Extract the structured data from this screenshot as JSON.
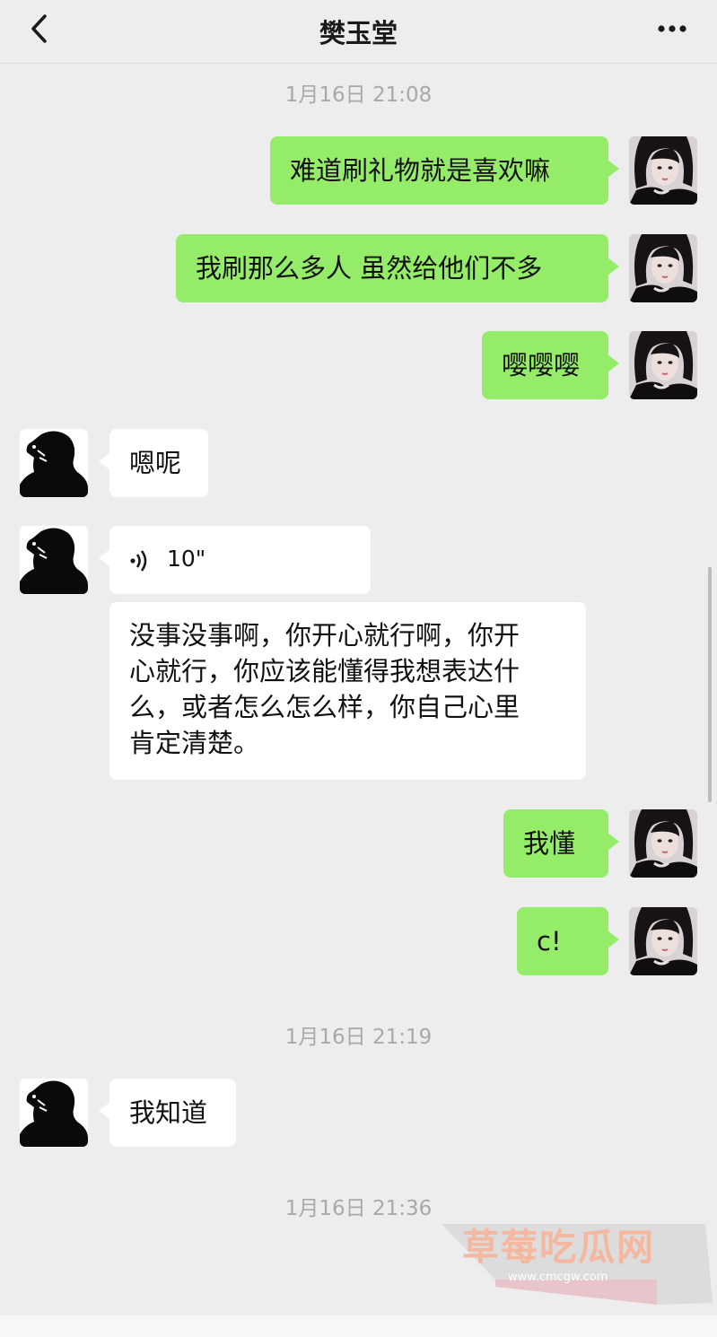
{
  "header": {
    "title": "樊玉堂"
  },
  "timestamps": [
    "1月16日 21:08",
    "1月16日 21:19",
    "1月16日 21:36"
  ],
  "messages": {
    "m1": "难道刷礼物就是喜欢嘛",
    "m2": "我刷那么多人 虽然给他们不多",
    "m3": "嘤嘤嘤",
    "m4": "嗯呢",
    "voice_duration": "10\"",
    "transcript_lines": [
      "没事没事啊，你开心就行啊，你开",
      "心就行，你应该能懂得我想表达什",
      "么，或者怎么怎么样，你自己心里",
      "肯定清楚。"
    ],
    "m6": "我懂",
    "m7": "c!",
    "m8": "我知道"
  },
  "watermark": {
    "text": "草莓吃瓜网",
    "url": "www.cmcgw.com"
  },
  "colors": {
    "bg": "#ededed",
    "me_bubble": "#95ec69",
    "them_bubble": "#ffffff",
    "timestamp": "#a9a9a9"
  }
}
